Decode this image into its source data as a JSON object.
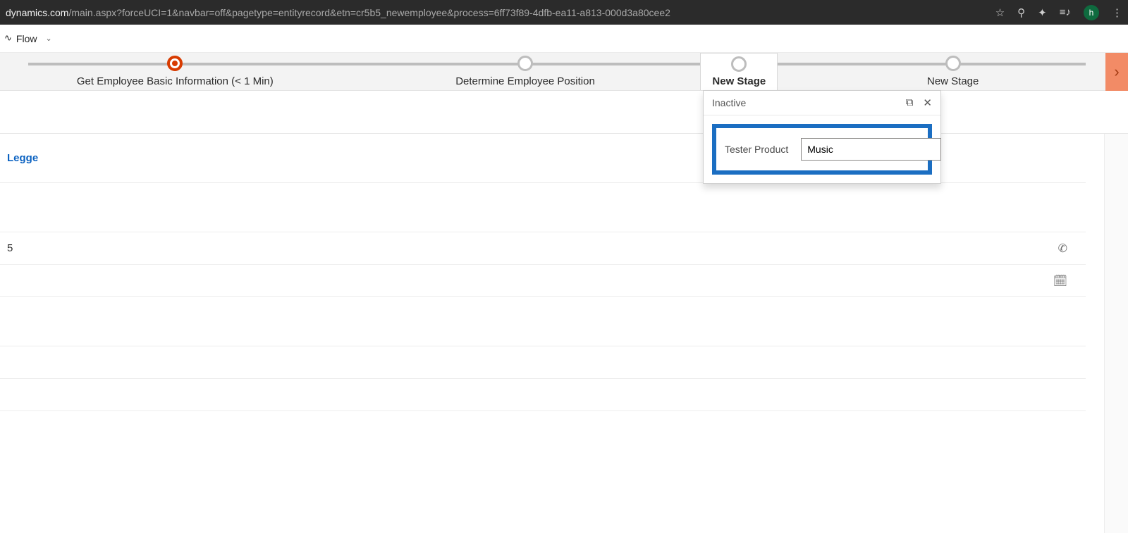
{
  "browser": {
    "url_host": "dynamics.com",
    "url_path": "/main.aspx?forceUCI=1&navbar=off&pagetype=entityrecord&etn=cr5b5_newemployee&process=6ff73f89-4dfb-ea11-a813-000d3a80cee2",
    "avatar_letter": "h"
  },
  "toolbar": {
    "flow_label": "Flow"
  },
  "stages": {
    "items": [
      {
        "label": "Get Employee Basic Information  (< 1 Min)",
        "active": true
      },
      {
        "label": "Determine Employee Position"
      },
      {
        "label": "New Stage",
        "selected": true
      },
      {
        "label": "New Stage"
      }
    ]
  },
  "flyout": {
    "status": "Inactive",
    "field_label": "Tester Product",
    "field_value": "Music"
  },
  "form": {
    "link_text": "Legge",
    "value1": "5"
  }
}
